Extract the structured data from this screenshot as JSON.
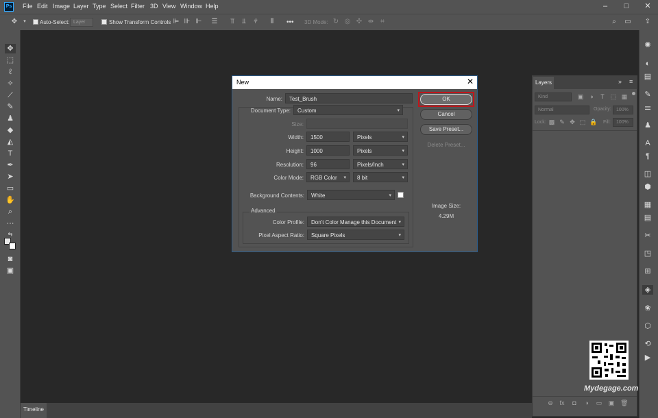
{
  "app": {
    "logo": "Ps",
    "menu": [
      "File",
      "Edit",
      "Image",
      "Layer",
      "Type",
      "Select",
      "Filter",
      "3D",
      "View",
      "Window",
      "Help"
    ],
    "window_controls": {
      "minimize": "–",
      "maximize": "□",
      "close": "✕"
    }
  },
  "options_bar": {
    "auto_select_label": "Auto-Select:",
    "auto_select_value": "Layer",
    "show_transform_label": "Show Transform Controls",
    "mode_3d_label": "3D Mode:",
    "more": "•••"
  },
  "dialog": {
    "title": "New",
    "name_label": "Name:",
    "name_value": "Test_Brush",
    "document_type_label": "Document Type:",
    "document_type_value": "Custom",
    "size_label": "Size:",
    "width_label": "Width:",
    "width_value": "1500",
    "width_unit": "Pixels",
    "height_label": "Height:",
    "height_value": "1000",
    "height_unit": "Pixels",
    "resolution_label": "Resolution:",
    "resolution_value": "96",
    "resolution_unit": "Pixels/Inch",
    "color_mode_label": "Color Mode:",
    "color_mode_value": "RGB Color",
    "bit_depth_value": "8 bit",
    "background_label": "Background Contents:",
    "background_value": "White",
    "advanced_label": "Advanced",
    "color_profile_label": "Color Profile:",
    "color_profile_value": "Don't Color Manage this Document",
    "pixel_aspect_label": "Pixel Aspect Ratio:",
    "pixel_aspect_value": "Square Pixels",
    "ok": "OK",
    "cancel": "Cancel",
    "save_preset": "Save Preset...",
    "delete_preset": "Delete Preset...",
    "image_size_label": "Image Size:",
    "image_size_value": "4.29M"
  },
  "layers_panel": {
    "tab": "Layers",
    "kind_placeholder": "Kind",
    "blend_mode": "Normal",
    "opacity_label": "Opacity:",
    "opacity_value": "100%",
    "lock_label": "Lock:",
    "fill_label": "Fill:",
    "fill_value": "100%",
    "footer_icons": [
      "⊖",
      "fx",
      "◘",
      "◑",
      "▭",
      "▣",
      "🗑"
    ]
  },
  "timeline": {
    "tab": "Timeline"
  },
  "watermark": {
    "text": "Mydegage.com"
  },
  "colors": {
    "accent_highlight": "#c0161c",
    "panel": "#535353",
    "canvas": "#282828"
  }
}
